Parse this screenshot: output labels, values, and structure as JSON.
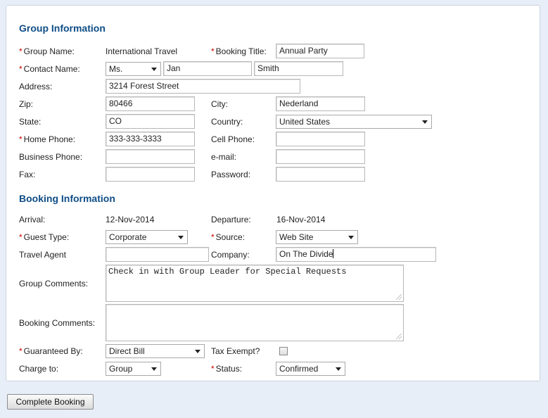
{
  "group_section": {
    "title": "Group Information",
    "group_name_label": "Group Name:",
    "group_name_value": "International Travel",
    "booking_title_label": "Booking Title:",
    "booking_title_value": "Annual Party",
    "contact_name_label": "Contact Name:",
    "salutation": "Ms.",
    "first_name": "Jan",
    "last_name": "Smith",
    "address_label": "Address:",
    "address_value": "3214 Forest Street",
    "zip_label": "Zip:",
    "zip_value": "80466",
    "city_label": "City:",
    "city_value": "Nederland",
    "state_label": "State:",
    "state_value": "CO",
    "country_label": "Country:",
    "country_value": "United States",
    "home_phone_label": "Home Phone:",
    "home_phone_value": "333-333-3333",
    "cell_phone_label": "Cell Phone:",
    "cell_phone_value": "",
    "business_phone_label": "Business Phone:",
    "business_phone_value": "",
    "email_label": "e-mail:",
    "email_value": "",
    "fax_label": "Fax:",
    "fax_value": "",
    "password_label": "Password:",
    "password_value": ""
  },
  "booking_section": {
    "title": "Booking Information",
    "arrival_label": "Arrival:",
    "arrival_value": "12-Nov-2014",
    "departure_label": "Departure:",
    "departure_value": "16-Nov-2014",
    "guest_type_label": "Guest Type:",
    "guest_type_value": "Corporate",
    "source_label": "Source:",
    "source_value": "Web Site",
    "travel_agent_label": "Travel Agent",
    "travel_agent_value": "",
    "company_label": "Company:",
    "company_value": "On The Divide",
    "group_comments_label": "Group Comments:",
    "group_comments_value": "Check in with Group Leader for Special Requests",
    "booking_comments_label": "Booking Comments:",
    "booking_comments_value": "",
    "guaranteed_by_label": "Guaranteed By:",
    "guaranteed_by_value": "Direct Bill",
    "tax_exempt_label": "Tax Exempt?",
    "charge_to_label": "Charge to:",
    "charge_to_value": "Group",
    "status_label": "Status:",
    "status_value": "Confirmed"
  },
  "actions": {
    "complete_booking_label": "Complete Booking"
  },
  "colors": {
    "section_title": "#0f4d86",
    "required_marker": "#cc0000",
    "page_background": "#e8eef7"
  }
}
